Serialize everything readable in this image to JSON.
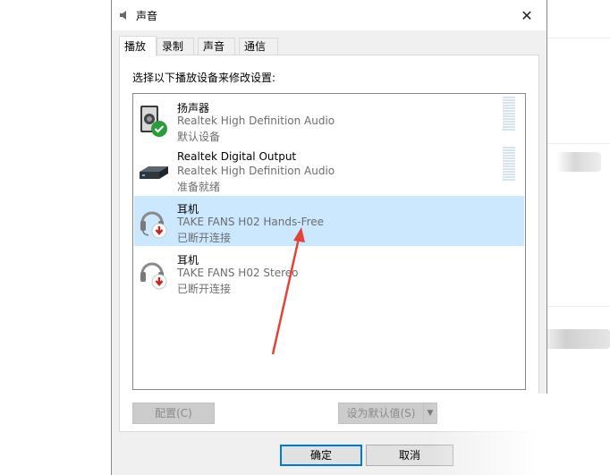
{
  "dialog": {
    "title": "声音",
    "close_symbol": "✕"
  },
  "tabs": [
    {
      "label": "播放",
      "active": true
    },
    {
      "label": "录制",
      "active": false
    },
    {
      "label": "声音",
      "active": false
    },
    {
      "label": "通信",
      "active": false
    }
  ],
  "instruction": "选择以下播放设备来修改设置:",
  "devices": [
    {
      "name": "扬声器",
      "description": "Realtek High Definition Audio",
      "status": "默认设备",
      "icon": "speaker-icon",
      "badge": "default-check-icon",
      "selected": false,
      "meter": true
    },
    {
      "name": "Realtek Digital Output",
      "description": "Realtek High Definition Audio",
      "status": "准备就绪",
      "icon": "digital-output-icon",
      "badge": "",
      "selected": false,
      "meter": true
    },
    {
      "name": "耳机",
      "description": "TAKE FANS H02 Hands-Free",
      "status": "已断开连接",
      "icon": "headset-icon",
      "badge": "disconnected-arrow-icon",
      "selected": true,
      "meter": false
    },
    {
      "name": "耳机",
      "description": "TAKE FANS H02 Stereo",
      "status": "已断开连接",
      "icon": "headphones-icon",
      "badge": "disconnected-arrow-icon",
      "selected": false,
      "meter": false
    }
  ],
  "buttons": {
    "configure": "配置(C)",
    "set_default": "设为默认值(S)",
    "ok": "确定",
    "cancel": "取消"
  },
  "colors": {
    "selection": "#cce8ff",
    "default_check": "#2a9d3a",
    "disconnected_badge": "#d02020",
    "annotation_arrow": "#e0443a"
  }
}
